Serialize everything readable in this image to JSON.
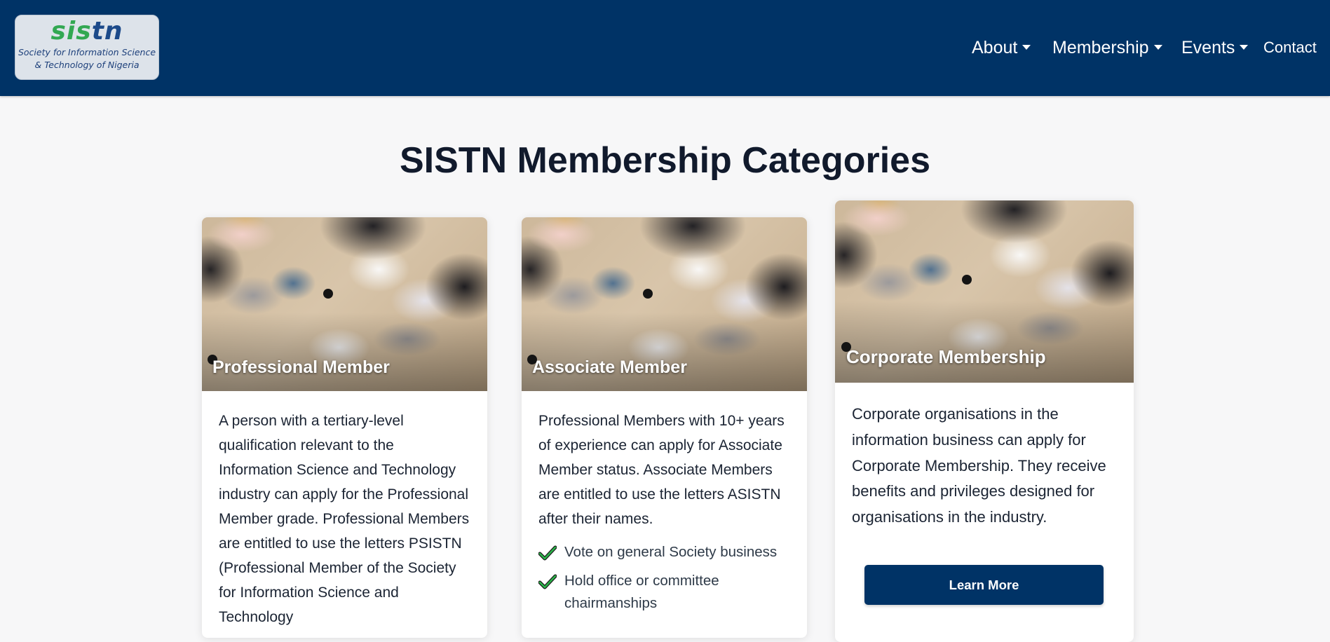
{
  "header": {
    "logo": {
      "mark": "sistn",
      "subtitle_line1": "Society for Information Science",
      "subtitle_line2": "& Technology of Nigeria"
    },
    "nav": [
      {
        "label": "About",
        "has_dropdown": true
      },
      {
        "label": "Membership",
        "has_dropdown": true
      },
      {
        "label": "Events",
        "has_dropdown": true
      },
      {
        "label": "Contact",
        "has_dropdown": false
      }
    ]
  },
  "main": {
    "title": "SISTN Membership Categories",
    "cards": [
      {
        "label": "Professional Member",
        "description": "A person with a tertiary-level qualification relevant to the Information Science and Technology industry can apply for the Professional Member grade. Professional Members are entitled to use the letters PSISTN (Professional Member of the Society for Information Science and Technology"
      },
      {
        "label": "Associate Member",
        "description": "Professional Members with 10+ years of experience can apply for Associate Member status. Associate Members are entitled to use the letters ASISTN after their names.",
        "benefits": [
          "Vote on general Society business",
          "Hold office or committee chairmanships"
        ]
      },
      {
        "label": "Corporate Membership",
        "description": "Corporate organisations in the information business can apply for Corporate Membership. They receive benefits and privileges designed for organisations in the industry.",
        "button_label": "Learn More"
      }
    ]
  },
  "colors": {
    "navbar": "#003366",
    "page_background": "#f7f7f8",
    "button": "#003366",
    "check_icon": "#2bb44a"
  },
  "icons": [
    "chevron-down-icon",
    "checkmark-icon"
  ]
}
